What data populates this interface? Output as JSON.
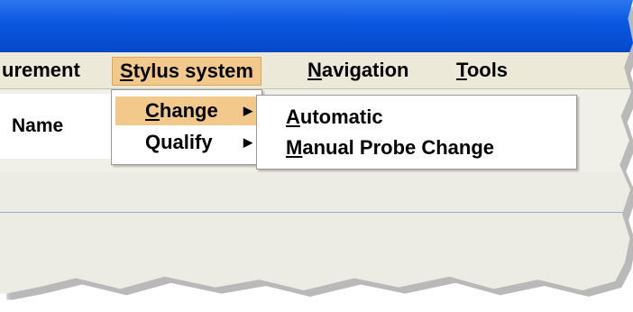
{
  "menubar": {
    "items": [
      {
        "label": "urement"
      },
      {
        "label": "Stylus system",
        "accel": "S",
        "rest": "tylus system"
      },
      {
        "label": "Navigation",
        "accel": "N",
        "rest": "avigation"
      },
      {
        "label": "Tools",
        "accel": "T",
        "rest": "ools"
      }
    ]
  },
  "table": {
    "name_header": "Name"
  },
  "submenu": {
    "items": [
      {
        "label": "Change",
        "accel": "C",
        "rest": "hange",
        "arrow": "▶"
      },
      {
        "label": "Qualify",
        "arrow": "▶"
      }
    ]
  },
  "change_submenu": {
    "items": [
      {
        "label": "Automatic",
        "accel": "A",
        "rest": "utomatic"
      },
      {
        "label": "Manual Probe Change",
        "accel": "M",
        "rest": "anual Probe Change"
      }
    ]
  },
  "colors": {
    "titlebar": "#0a57e0",
    "highlight": "#f2c98a",
    "menubar": "#ece9d8"
  }
}
